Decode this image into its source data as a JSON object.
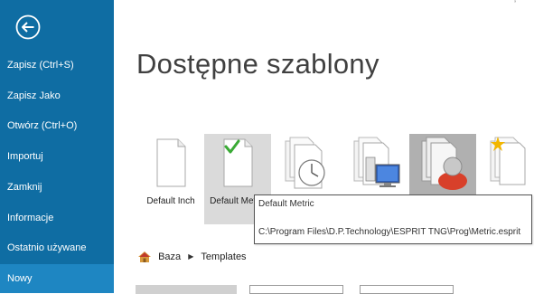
{
  "sidebar": {
    "back_icon": "arrow-left-circle-icon",
    "items": [
      {
        "label": "Zapisz (Ctrl+S)",
        "active": false
      },
      {
        "label": "Zapisz Jako",
        "active": false
      },
      {
        "label": "Otwórz (Ctrl+O)",
        "active": false
      },
      {
        "label": "Importuj",
        "active": false
      },
      {
        "label": "Zamknij",
        "active": false
      },
      {
        "label": "Informacje",
        "active": false
      },
      {
        "label": "Ostatnio używane",
        "active": false
      },
      {
        "label": "Nowy",
        "active": true
      }
    ]
  },
  "main": {
    "title": "Dostępne szablony",
    "templates": [
      {
        "label": "Default Inch",
        "icon": "blank-document-icon",
        "selected": false
      },
      {
        "label": "Default Metric",
        "icon": "document-checkmark-icon",
        "selected": true
      },
      {
        "label": "",
        "icon": "document-clock-icon",
        "selected": false
      },
      {
        "label": "",
        "icon": "document-computer-icon",
        "selected": false
      },
      {
        "label": "",
        "icon": "document-user-icon",
        "selected": false
      },
      {
        "label": "",
        "icon": "document-sparkle-icon",
        "selected": false
      }
    ],
    "tooltip": {
      "name": "Default Metric",
      "path": "C:\\Program Files\\D.P.Technology\\ESPRIT TNG\\Prog\\Metric.esprit"
    },
    "breadcrumb": {
      "home_icon": "home-icon",
      "root": "Baza",
      "current": "Templates"
    }
  },
  "colors": {
    "sidebar_bg": "#0F6DA3",
    "sidebar_active": "#1E86C2",
    "title_text": "#404040",
    "tile_selected": "#DADADA",
    "check_green": "#3AAA35"
  }
}
